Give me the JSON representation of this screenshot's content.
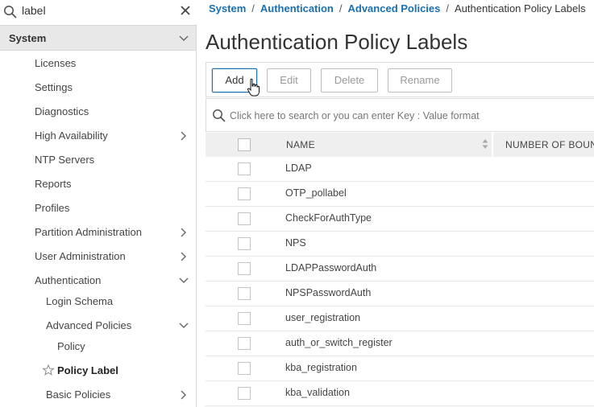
{
  "sidebar": {
    "search_value": "label",
    "system_label": "System",
    "items": [
      {
        "label": "Licenses"
      },
      {
        "label": "Settings"
      },
      {
        "label": "Diagnostics"
      },
      {
        "label": "High Availability"
      },
      {
        "label": "NTP Servers"
      },
      {
        "label": "Reports"
      },
      {
        "label": "Profiles"
      },
      {
        "label": "Partition Administration"
      },
      {
        "label": "User Administration"
      },
      {
        "label": "Authentication"
      },
      {
        "label": "Login Schema"
      },
      {
        "label": "Advanced Policies"
      },
      {
        "label": "Policy"
      },
      {
        "label": "Policy Label"
      },
      {
        "label": "Basic Policies"
      }
    ]
  },
  "breadcrumb": {
    "items": [
      "System",
      "Authentication",
      "Advanced Policies"
    ],
    "separator": "/",
    "current": "Authentication Policy Labels"
  },
  "page": {
    "title": "Authentication Policy Labels"
  },
  "toolbar": {
    "add_label": "Add",
    "edit_label": "Edit",
    "delete_label": "Delete",
    "rename_label": "Rename"
  },
  "table": {
    "search_placeholder": "Click here to search or you can enter Key : Value format",
    "columns": [
      "NAME",
      "NUMBER OF BOUND"
    ],
    "rows": [
      {
        "name": "LDAP"
      },
      {
        "name": "OTP_pollabel"
      },
      {
        "name": "CheckForAuthType"
      },
      {
        "name": "NPS"
      },
      {
        "name": "LDAPPasswordAuth"
      },
      {
        "name": "NPSPasswordAuth"
      },
      {
        "name": "user_registration"
      },
      {
        "name": "auth_or_switch_register"
      },
      {
        "name": "kba_registration"
      },
      {
        "name": "kba_validation"
      }
    ]
  },
  "colors": {
    "accent": "#1a6fb0",
    "header_bg": "#efefef",
    "selected_bg": "#e8e8e8"
  }
}
